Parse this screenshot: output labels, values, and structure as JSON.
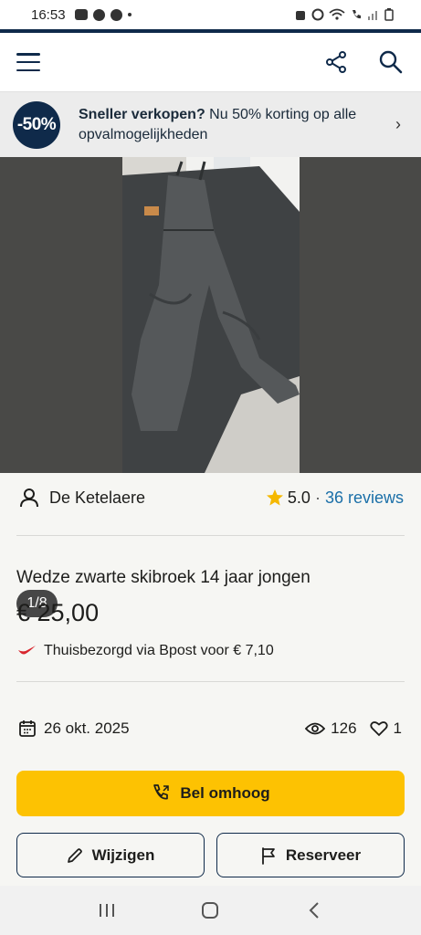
{
  "status_bar": {
    "time": "16:53"
  },
  "header": {
    "menu_icon": "hamburger-icon",
    "share_icon": "share-icon",
    "search_icon": "search-icon"
  },
  "promo": {
    "badge": "-50%",
    "bold_text": "Sneller verkopen?",
    "text": " Nu 50% korting op alle opvalmogelijkheden",
    "chevron": "›"
  },
  "gallery": {
    "counter": "1/8"
  },
  "seller": {
    "name": "De Ketelaere",
    "rating": "5.0",
    "separator": "·",
    "reviews": "36 reviews"
  },
  "listing": {
    "title": "Wedze zwarte skibroek 14 jaar jongen",
    "price": "€ 25,00",
    "shipping": "Thuisbezorgd via Bpost voor",
    "shipping_price": "€ 7,10"
  },
  "meta": {
    "date": "26 okt. 2025",
    "views": "126",
    "favorites": "1"
  },
  "actions": {
    "call": "Bel omhoog",
    "edit": "Wijzigen",
    "reserve": "Reserveer"
  },
  "colors": {
    "brand_navy": "#0f2a4a",
    "primary_button": "#fdc202",
    "link": "#1a6fa8",
    "star": "#f5b800"
  }
}
